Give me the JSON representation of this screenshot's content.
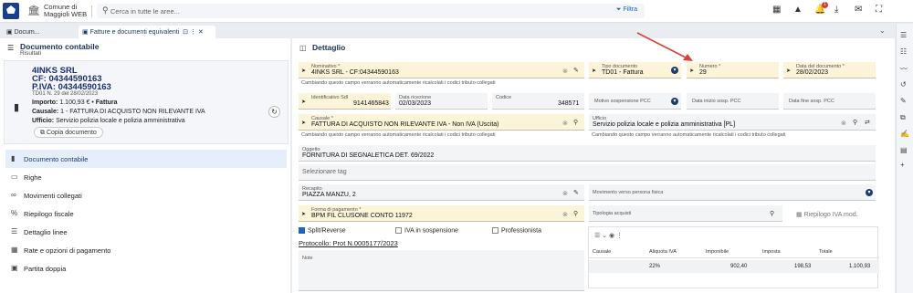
{
  "header": {
    "org_line1": "Comune di",
    "org_line2": "Maggioli WEB",
    "search_placeholder": "Cerca in tutte le aree...",
    "filter_label": "Filtra",
    "notifications_count": "1"
  },
  "tabs": [
    {
      "label": "Docum...",
      "active": false
    },
    {
      "label": "Fatture e documenti equivalenti",
      "active": true
    }
  ],
  "left": {
    "title": "Documento contabile",
    "subtitle": "Risultati",
    "card": {
      "name_line1": "4INKS SRL",
      "name_line2": "CF: 04344590163",
      "name_line3": "P.IVA: 04344590163",
      "td_line": "TD01 N. 29 del 28/02/2023",
      "importo_label": "Importo:",
      "importo_value": "1.100,93 €",
      "importo_type": "Fattura",
      "causale_label": "Causale:",
      "causale_value": "1 - FATTURA DI ACQUISTO NON RILEVANTE IVA",
      "ufficio_label": "Ufficio:",
      "ufficio_value": "Servizio polizia locale e polizia amministrativa",
      "copy_label": "Copia documento"
    },
    "menu": [
      {
        "label": "Documento contabile",
        "icon": "document-icon",
        "active": true
      },
      {
        "label": "Righe",
        "icon": "rows-icon",
        "active": false
      },
      {
        "label": "Movimenti collegati",
        "icon": "link-icon",
        "active": false
      },
      {
        "label": "Riepilogo fiscale",
        "icon": "percent-icon",
        "active": false
      },
      {
        "label": "Dettaglio linee",
        "icon": "list-icon",
        "active": false
      },
      {
        "label": "Rate e opzioni di pagamento",
        "icon": "grid-icon",
        "active": false
      },
      {
        "label": "Partita doppia",
        "icon": "ledger-icon",
        "active": false
      }
    ]
  },
  "detail": {
    "title": "Dettaglio",
    "nominativo": {
      "label": "Nominativo *",
      "value": "4INKS SRL - CF:04344590163"
    },
    "hint_nominativo": "Cambiando questo campo verranno automaticamente ricalcolati i codici tributo collegati",
    "tipo_documento": {
      "label": "Tipo documento",
      "value": "TD01 - Fattura"
    },
    "numero": {
      "label": "Numero *",
      "value": "29"
    },
    "data_documento": {
      "label": "Data del documento *",
      "value": "28/02/2023"
    },
    "identificativo_sdi": {
      "label": "Identificativo SdI",
      "value": "9141465843"
    },
    "data_ricezione": {
      "label": "Data ricezione",
      "value": "02/03/2023"
    },
    "codice": {
      "label": "Codice",
      "value": "348571"
    },
    "motivo_sospensione": {
      "label": "Motivo sospensione PCC",
      "value": ""
    },
    "data_inizio_sosp": {
      "label": "Data inizio sosp. PCC",
      "value": ""
    },
    "data_fine_sosp": {
      "label": "Data fine sosp. PCC",
      "value": ""
    },
    "causale": {
      "label": "Causale *",
      "value": "FATTURA DI ACQUISTO NON RILEVANTE IVA - Non IVA (Uscita)"
    },
    "hint_causale": "Cambiando questo campo verranno automaticamente ricalcolati i codici tributo collegati",
    "ufficio": {
      "label": "Ufficio",
      "value": "Servizio polizia locale e polizia amministrativa [PL]"
    },
    "hint_ufficio": "Cambiando questo campo verranno automaticamente ricalcolati i codici tributo collegati",
    "oggetto": {
      "label": "Oggetto",
      "value": "FORNITURA DI SEGNALETICA DET. 69/2022"
    },
    "tag_placeholder": "Selezionare tag",
    "recapito": {
      "label": "Recapito",
      "value": "PIAZZA MANZU, 2"
    },
    "movimento_verso": {
      "label": "Movimento verso persona fisica",
      "value": ""
    },
    "forma_pagamento": {
      "label": "Forma di pagamento *",
      "value": "BPM FIL CLUSONE CONTO 11972"
    },
    "tipologia_acquisti": {
      "label": "Tipologia acquisti",
      "value": ""
    },
    "riepilogo_iva_label": "Riepilogo IVA mod.",
    "checkbox_split": "Split/Reverse",
    "checkbox_iva_sosp": "IVA in sospensione",
    "checkbox_professionista": "Professionista",
    "protocollo": "Protocollo: Prot N.0005177/2023",
    "note_label": "Note",
    "table": {
      "columns": [
        "Causale",
        "Aliquota IVA",
        "Imponibile",
        "Imposta",
        "Totale"
      ],
      "rows": [
        [
          "",
          "22%",
          "902,40",
          "198,53",
          "1.100,93"
        ]
      ]
    }
  },
  "colors": {
    "accent": "#1c62c7",
    "mandatory_field_bg": "#fcf4d9",
    "arrow": "#d9413a"
  }
}
